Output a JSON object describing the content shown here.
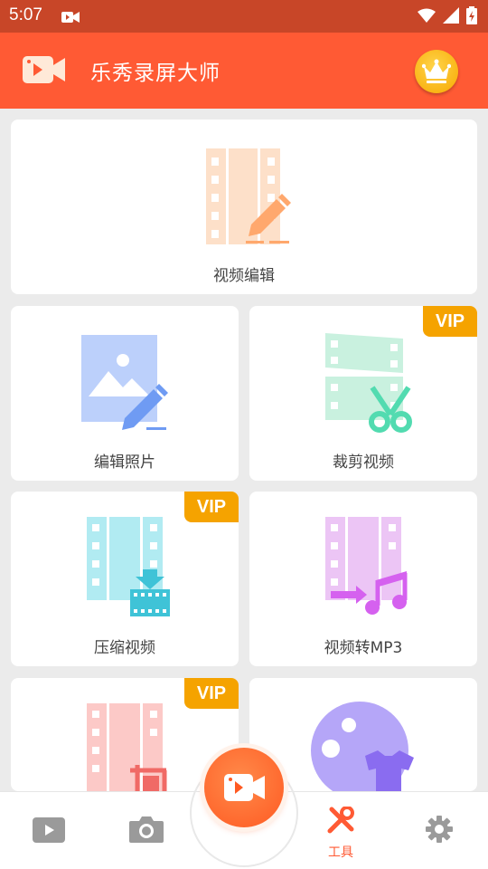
{
  "status_bar": {
    "time": "5:07"
  },
  "app_bar": {
    "title": "乐秀录屏大师"
  },
  "tools": {
    "video_edit": {
      "label": "视频编辑"
    },
    "edit_photo": {
      "label": "编辑照片"
    },
    "trim_video": {
      "label": "裁剪视频",
      "badge": "VIP"
    },
    "compress_video": {
      "label": "压缩视频",
      "badge": "VIP"
    },
    "video_to_mp3": {
      "label": "视频转MP3"
    },
    "crop_video": {
      "badge": "VIP"
    }
  },
  "bottom_nav": {
    "tools_label": "工具"
  },
  "colors": {
    "accent": "#ff5a34",
    "status_bar": "#c84628",
    "vip_badge": "#f5a300",
    "crown": "#f7a800"
  },
  "icons": [
    "record-icon",
    "wifi-icon",
    "signal-icon",
    "battery-icon",
    "crown-icon",
    "play-icon",
    "camera-icon",
    "tools-icon",
    "settings-icon"
  ]
}
